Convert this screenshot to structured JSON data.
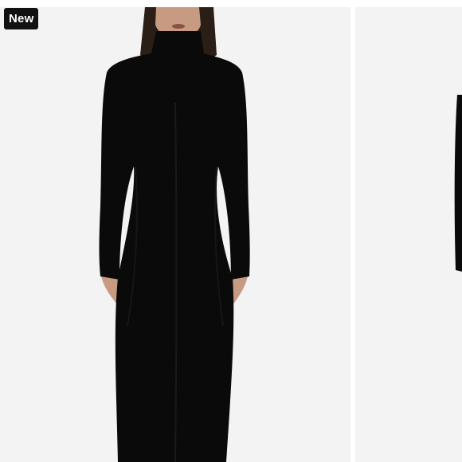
{
  "badge": {
    "label": "New"
  },
  "product_images": [
    {
      "subject": "model-black-turtleneck-maxi-dress-front"
    },
    {
      "subject": "model-black-turtleneck-maxi-dress-side"
    }
  ],
  "colors": {
    "badge_background": "#111111",
    "badge_text": "#ffffff",
    "image_background": "#f3f3f3",
    "dress": "#0a0a0a"
  }
}
